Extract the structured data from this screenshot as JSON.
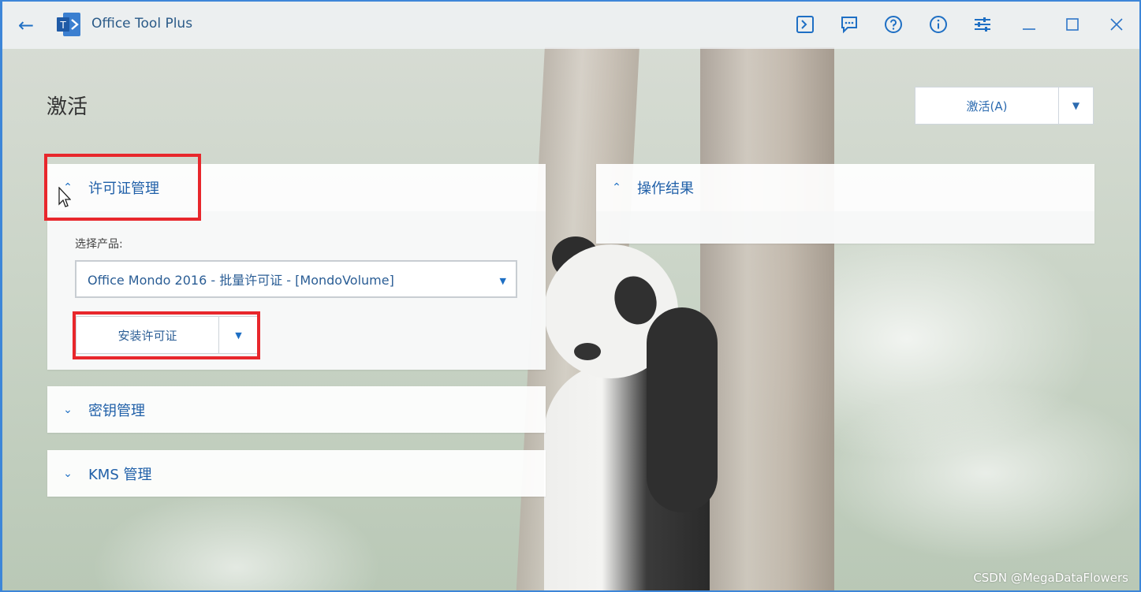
{
  "window": {
    "title": "Office Tool Plus",
    "logo_text": "T",
    "toolbar_icons": [
      "terminal-icon",
      "feedback-icon",
      "help-icon",
      "info-icon",
      "settings-icon"
    ],
    "window_controls": [
      "minimize-icon",
      "maximize-icon",
      "close-icon"
    ]
  },
  "page": {
    "title": "激活",
    "activate_button": "激活(A)"
  },
  "license_panel": {
    "header": "许可证管理",
    "expanded": true,
    "select_label": "选择产品:",
    "selected_product": "Office Mondo 2016 - 批量许可证 - [MondoVolume]",
    "install_button": "安装许可证"
  },
  "key_panel": {
    "header": "密钥管理",
    "expanded": false
  },
  "kms_panel": {
    "header": "KMS 管理",
    "expanded": false
  },
  "result_panel": {
    "header": "操作结果",
    "expanded": true
  },
  "watermark": "CSDN @MegaDataFlowers",
  "colors": {
    "accent": "#1e6fc4",
    "highlight": "#e8272c",
    "window_border": "#3d86d8"
  }
}
